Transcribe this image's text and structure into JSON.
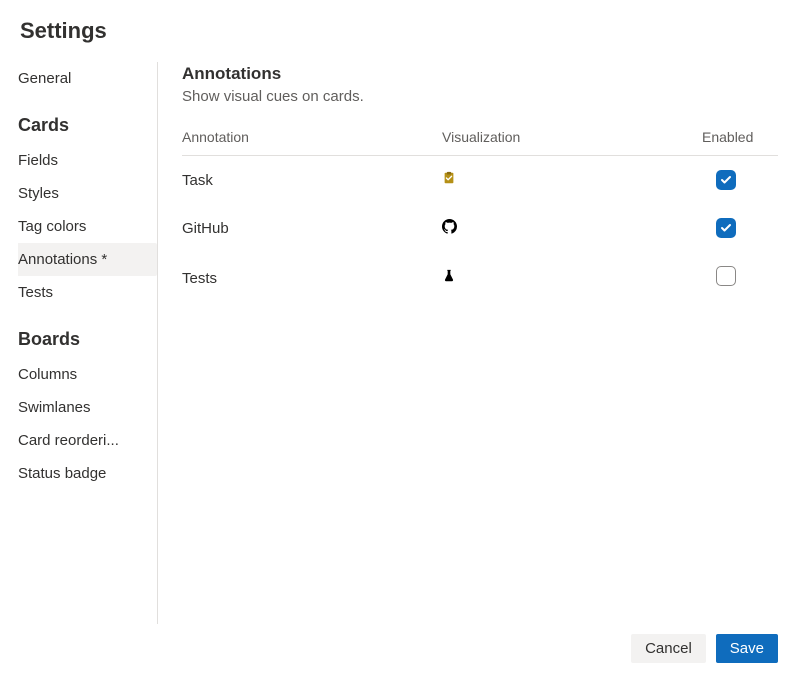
{
  "pageTitle": "Settings",
  "sidebar": {
    "general": "General",
    "cardsHeading": "Cards",
    "cardsItems": {
      "fields": "Fields",
      "styles": "Styles",
      "tagColors": "Tag colors",
      "annotations": "Annotations *",
      "tests": "Tests"
    },
    "boardsHeading": "Boards",
    "boardsItems": {
      "columns": "Columns",
      "swimlanes": "Swimlanes",
      "cardReordering": "Card reorderi...",
      "statusBadge": "Status badge"
    }
  },
  "section": {
    "title": "Annotations",
    "subtitle": "Show visual cues on cards."
  },
  "table": {
    "headers": {
      "annotation": "Annotation",
      "visualization": "Visualization",
      "enabled": "Enabled"
    },
    "rows": [
      {
        "name": "Task",
        "icon": "clipboard",
        "enabled": true
      },
      {
        "name": "GitHub",
        "icon": "github",
        "enabled": true
      },
      {
        "name": "Tests",
        "icon": "beaker",
        "enabled": false
      }
    ]
  },
  "footer": {
    "cancel": "Cancel",
    "save": "Save"
  }
}
